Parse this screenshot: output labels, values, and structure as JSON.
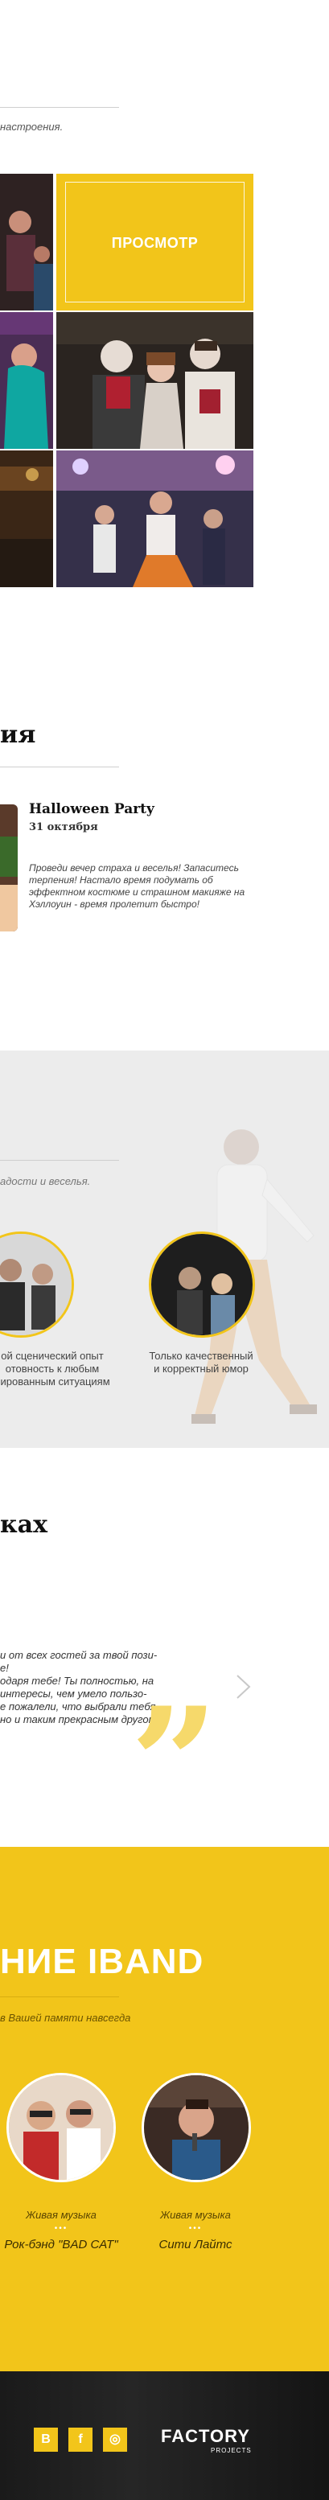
{
  "intro": {
    "tagline": "настроения."
  },
  "gallery": {
    "view_label": "ПРОСМОТР"
  },
  "events": {
    "title": "ия",
    "item": {
      "title": "Halloween Party",
      "date": "31 октября",
      "description": "Проведи вечер страха и веселья! Запаситесь терпения! Настало время подумать об эффектном костюме и страшном макияже на Хэллоуин - время пролетит быстро!"
    }
  },
  "features": {
    "tagline": "адости и веселья.",
    "items": [
      {
        "caption": "ой сценический опыт\nотовность к любым\nнированным ситуациям"
      },
      {
        "caption": "Только качественный\nи корректный юмор"
      }
    ]
  },
  "reviews": {
    "title": "ках",
    "text": "и от всех гостей за твой пози-\nе! \nодаря тебе! Ты полностью, на\nинтересы, чем умело пользо-\nе пожалели, что выбрали тебя,\nно и таким прекрасным другом",
    "next_icon": "chevron-right-icon",
    "quote_icon": "quote-icon"
  },
  "band": {
    "title": "НИЕ IBAND",
    "subtitle": "в Вашей памяти навсегда",
    "dots": "•••",
    "items": [
      {
        "type": "Живая музыка",
        "name": "Рок-бэнд \"BAD CAT\""
      },
      {
        "type": "Живая музыка",
        "name": "Сити Лайтс"
      }
    ]
  },
  "footer": {
    "social": [
      {
        "icon": "vk-icon",
        "glyph": "B"
      },
      {
        "icon": "facebook-icon",
        "glyph": "f"
      },
      {
        "icon": "instagram-icon",
        "glyph": "◎"
      }
    ],
    "logo_main": "FACTORY",
    "logo_sub": "PROJECTS"
  },
  "colors": {
    "accent": "#f2c51a",
    "dark": "#111111",
    "light_bg": "#ececec"
  }
}
